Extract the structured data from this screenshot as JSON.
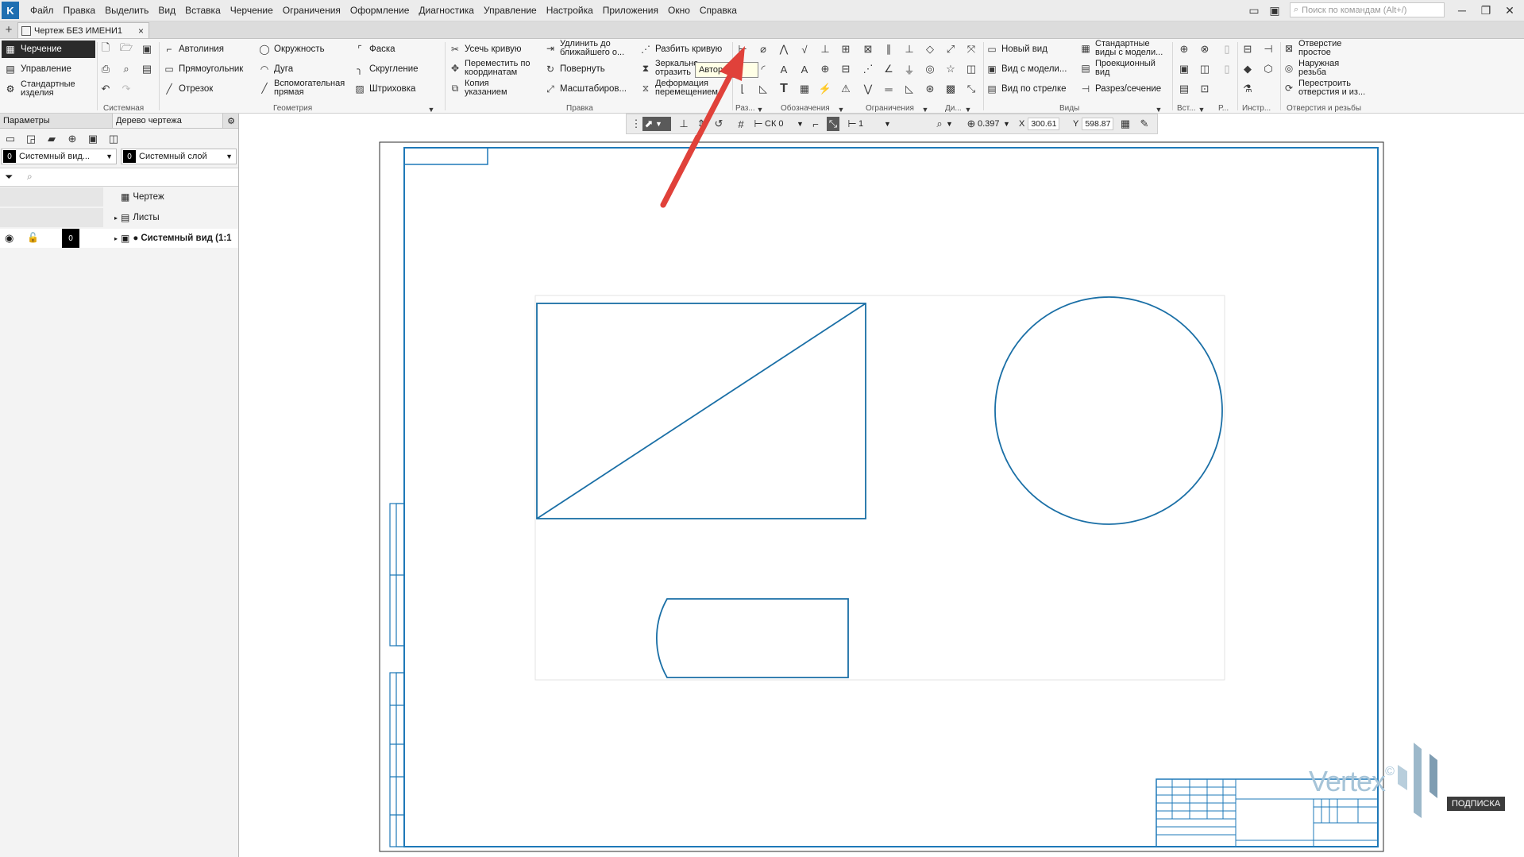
{
  "menu": {
    "logo": "K",
    "items": [
      "Файл",
      "Правка",
      "Выделить",
      "Вид",
      "Вставка",
      "Черчение",
      "Ограничения",
      "Оформление",
      "Диагностика",
      "Управление",
      "Настройка",
      "Приложения",
      "Окно",
      "Справка"
    ],
    "search_placeholder": "Поиск по командам (Alt+/)"
  },
  "tab": {
    "title": "Чертеж БЕЗ ИМЕНИ1",
    "close": "×",
    "add": "+"
  },
  "ribbon": {
    "modes": [
      "Черчение",
      "Управление",
      "Стандартные изделия"
    ],
    "geometry": [
      "Автолиния",
      "Прямоугольник",
      "Отрезок",
      "Окружность",
      "Дуга",
      "Вспомогательная прямая",
      "Фаска",
      "Скругление",
      "Штриховка"
    ],
    "edit": [
      "Усечь кривую",
      "Переместить по координатам",
      "Копия указанием",
      "Удлинить до ближайшего о...",
      "Повернуть",
      "Масштабиров...",
      "Разбить кривую",
      "Зеркально отразить",
      "Деформация перемещением"
    ],
    "views": [
      "Новый вид",
      "Вид с модели...",
      "Вид по стрелке",
      "Стандартные виды с модели...",
      "Проекционный вид",
      "Разрез/сечение"
    ],
    "holes": [
      "Отверстие простое",
      "Наружная резьба",
      "Перестроить отверстия и из..."
    ],
    "group_labels": {
      "system": "Системная",
      "geometry": "Геометрия",
      "edit": "Правка",
      "dimensions": "Раз...",
      "notation": "Обозначения",
      "constraints": "Ограничения",
      "di": "Ди...",
      "views": "Виды",
      "insert": "Вст...",
      "r": "Р...",
      "instr": "Инстр...",
      "holes": "Отверстия и резьбы"
    },
    "tooltip": "Авторе...о"
  },
  "left_panel": {
    "tabs": [
      "Параметры",
      "Дерево чертежа"
    ],
    "view_select": {
      "num": "0",
      "label": "Системный вид..."
    },
    "layer_select": {
      "num": "0",
      "label": "Системный слой"
    },
    "tree": [
      "Чертеж",
      "Листы",
      "Системный вид (1:1"
    ],
    "row_num": "0"
  },
  "canvas_toolbar": {
    "cs": "СК 0",
    "step": "1",
    "zoom": "0.397",
    "x_label": "X",
    "x_value": "300.61",
    "y_label": "Y",
    "y_value": "598.87"
  },
  "watermark": {
    "text": "Vertex",
    "mark": "©",
    "badge": "ПОДПИСКА"
  },
  "colors": {
    "line": "#1a6fa6",
    "frame": "#1e79b8",
    "arrow": "#e0413a"
  }
}
